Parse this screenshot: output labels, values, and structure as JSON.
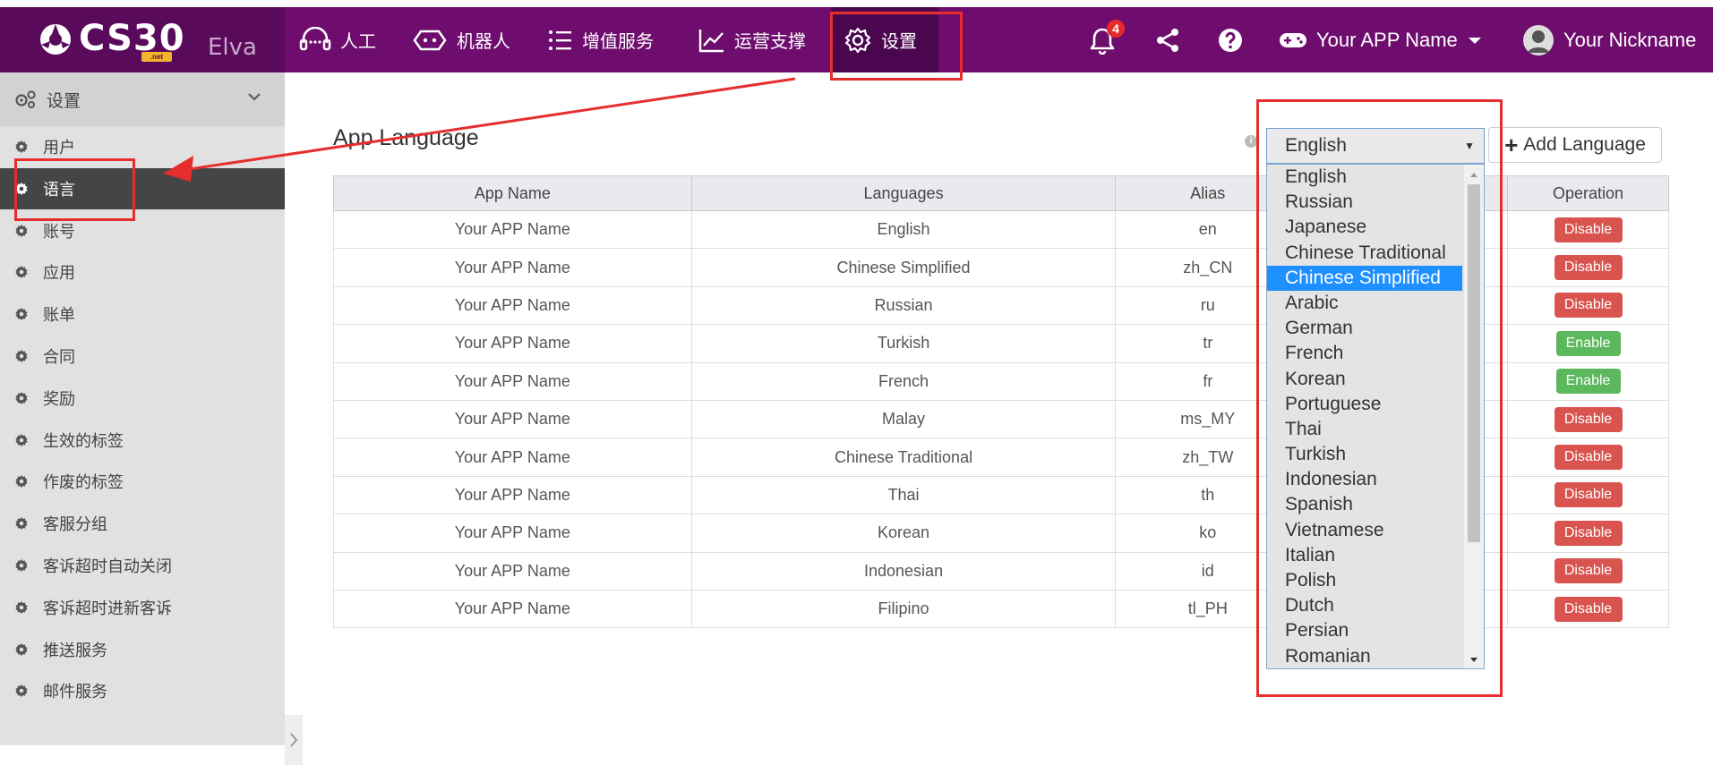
{
  "app": {
    "logo_text": "CS30",
    "logo_badge": ".net",
    "user_short": "Elva"
  },
  "nav": {
    "items": [
      {
        "label": "人工"
      },
      {
        "label": "机器人"
      },
      {
        "label": "增值服务"
      },
      {
        "label": "运营支撑"
      },
      {
        "label": "设置"
      }
    ],
    "notification_count": "4",
    "app_name": "Your APP Name",
    "nickname": "Your Nickname"
  },
  "sidebar": {
    "header": "设置",
    "items": [
      {
        "label": "用户"
      },
      {
        "label": "语言"
      },
      {
        "label": "账号"
      },
      {
        "label": "应用"
      },
      {
        "label": "账单"
      },
      {
        "label": "合同"
      },
      {
        "label": "奖励"
      },
      {
        "label": "生效的标签"
      },
      {
        "label": "作废的标签"
      },
      {
        "label": "客服分组"
      },
      {
        "label": "客诉超时自动关闭"
      },
      {
        "label": "客诉超时进新客诉"
      },
      {
        "label": "推送服务"
      },
      {
        "label": "邮件服务"
      }
    ]
  },
  "main": {
    "title": "App Language",
    "select_value": "English",
    "add_button": "Add Language",
    "columns": [
      "App Name",
      "Languages",
      "Alias",
      "",
      "Operation"
    ],
    "rows": [
      {
        "app": "Your APP Name",
        "lang": "English",
        "alias": "en",
        "op": "Disable"
      },
      {
        "app": "Your APP Name",
        "lang": "Chinese Simplified",
        "alias": "zh_CN",
        "op": "Disable"
      },
      {
        "app": "Your APP Name",
        "lang": "Russian",
        "alias": "ru",
        "op": "Disable"
      },
      {
        "app": "Your APP Name",
        "lang": "Turkish",
        "alias": "tr",
        "op": "Enable"
      },
      {
        "app": "Your APP Name",
        "lang": "French",
        "alias": "fr",
        "op": "Enable"
      },
      {
        "app": "Your APP Name",
        "lang": "Malay",
        "alias": "ms_MY",
        "op": "Disable"
      },
      {
        "app": "Your APP Name",
        "lang": "Chinese Traditional",
        "alias": "zh_TW",
        "op": "Disable"
      },
      {
        "app": "Your APP Name",
        "lang": "Thai",
        "alias": "th",
        "op": "Disable"
      },
      {
        "app": "Your APP Name",
        "lang": "Korean",
        "alias": "ko",
        "op": "Disable"
      },
      {
        "app": "Your APP Name",
        "lang": "Indonesian",
        "alias": "id",
        "op": "Disable"
      },
      {
        "app": "Your APP Name",
        "lang": "Filipino",
        "alias": "tl_PH",
        "op": "Disable"
      }
    ],
    "dropdown_options": [
      "English",
      "Russian",
      "Japanese",
      "Chinese Traditional",
      "Chinese Simplified",
      "Arabic",
      "German",
      "French",
      "Korean",
      "Portuguese",
      "Thai",
      "Turkish",
      "Indonesian",
      "Spanish",
      "Vietnamese",
      "Italian",
      "Polish",
      "Dutch",
      "Persian",
      "Romanian"
    ],
    "dropdown_selected": "Chinese Simplified"
  },
  "colors": {
    "topbar": "#6e0d6e",
    "highlight": "#e62e2e",
    "disable": "#d9534f",
    "enable": "#5cb85c",
    "selected": "#1e90ff"
  }
}
